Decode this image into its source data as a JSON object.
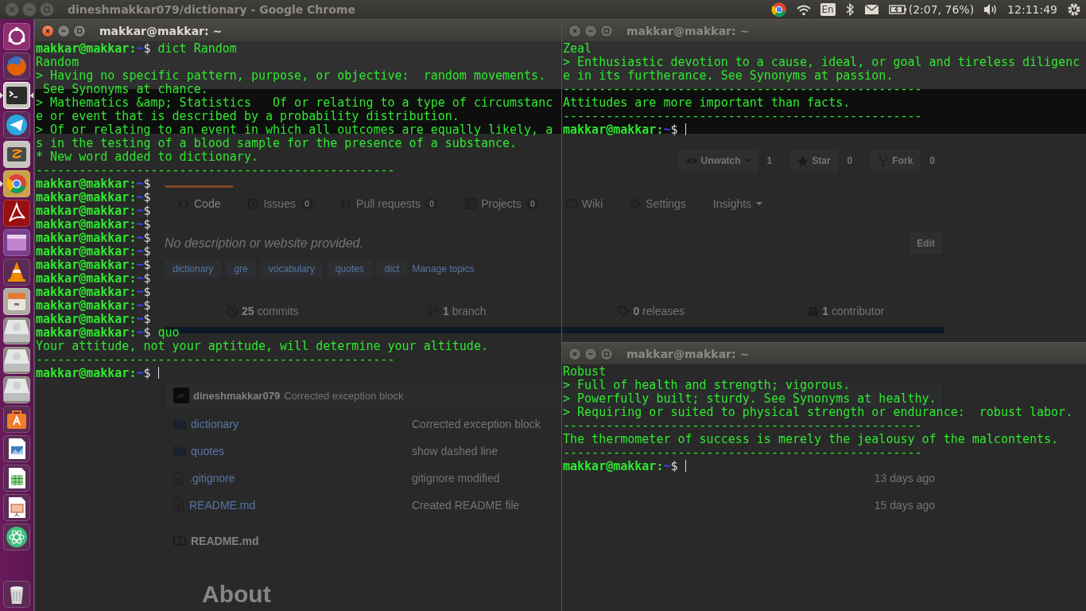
{
  "top_panel": {
    "window_title": "dineshmakkar079/dictionary - Google Chrome",
    "keyboard_layout": "En",
    "battery": "(2:07, 76%)",
    "clock": "12:11:49"
  },
  "launcher": [
    {
      "running": false,
      "focused": false
    },
    {
      "running": false,
      "focused": false
    },
    {
      "running": true,
      "focused": true
    },
    {
      "running": false,
      "focused": false
    },
    {
      "running": false,
      "focused": false
    },
    {
      "running": true,
      "focused": false
    },
    {
      "running": false,
      "focused": false
    },
    {
      "running": false,
      "focused": false
    },
    {
      "running": false,
      "focused": false
    },
    {
      "running": false,
      "focused": false
    },
    {
      "running": false,
      "focused": false
    },
    {
      "running": false,
      "focused": false
    },
    {
      "running": false,
      "focused": false
    },
    {
      "running": false,
      "focused": false
    },
    {
      "running": false,
      "focused": false
    },
    {
      "running": false,
      "focused": false
    },
    {
      "running": false,
      "focused": false
    },
    {
      "running": false,
      "focused": false
    },
    {
      "running": false,
      "focused": false
    }
  ],
  "browser_page": {
    "watch_buttons": [
      {
        "label": "Unwatch",
        "count": "1"
      },
      {
        "label": "Star",
        "count": "0"
      },
      {
        "label": "Fork",
        "count": "0"
      }
    ],
    "tabs": [
      {
        "label": "Code",
        "selected": true
      },
      {
        "label": "Issues",
        "count": "0",
        "selected": false
      },
      {
        "label": "Pull requests",
        "count": "0",
        "selected": false
      },
      {
        "label": "Projects",
        "count": "0",
        "selected": false
      },
      {
        "label": "Wiki",
        "selected": false
      },
      {
        "label": "Settings",
        "selected": false
      },
      {
        "label": "Insights",
        "selected": false
      }
    ],
    "description": "No description or website provided.",
    "edit_button": "Edit",
    "topics": [
      "dictionary",
      "gre",
      "vocabulary",
      "quotes",
      "dict"
    ],
    "manage_topics": "Manage topics",
    "stats": [
      {
        "count": "25",
        "label": "commits"
      },
      {
        "count": "1",
        "label": "branch"
      },
      {
        "count": "0",
        "label": "releases"
      },
      {
        "count": "1",
        "label": "contributor"
      }
    ],
    "last_commit": {
      "author": "dineshmakkar079",
      "message": "Corrected exception block"
    },
    "files": [
      {
        "kind": "folder",
        "name": "dictionary",
        "message": "Corrected exception block"
      },
      {
        "kind": "folder",
        "name": "quotes",
        "message": "show dashed line"
      },
      {
        "kind": "file",
        "name": ".gitignore",
        "message": "gitignore modified",
        "age": "13 days ago"
      },
      {
        "kind": "file",
        "name": "README.md",
        "message": "Created README file",
        "age": "15 days ago"
      }
    ],
    "readme": {
      "title": "README.md",
      "heading": "About"
    }
  },
  "terminals": [
    {
      "title": "makkar@makkar: ~",
      "active": true,
      "lines": [
        {
          "kind": "prompt",
          "user": "makkar@makkar:",
          "path": "~",
          "symbol": "$",
          "command": "dict Random",
          "cursor": false
        },
        {
          "kind": "output",
          "text": "Random"
        },
        {
          "kind": "output",
          "text": "> Having no specific pattern, purpose, or objective:  random movements."
        },
        {
          "kind": "output",
          "text": " See Synonyms at chance."
        },
        {
          "kind": "output",
          "text": "> Mathematics &amp; Statistics   Of or relating to a type of circumstanc"
        },
        {
          "kind": "output",
          "text": "e or event that is described by a probability distribution."
        },
        {
          "kind": "output",
          "text": "> Of or relating to an event in which all outcomes are equally likely, a"
        },
        {
          "kind": "output",
          "text": "s in the testing of a blood sample for the presence of a substance."
        },
        {
          "kind": "output",
          "text": "* New word added to dictionary."
        },
        {
          "kind": "rule",
          "text": "--------------------------------------------------"
        },
        {
          "kind": "prompt",
          "user": "makkar@makkar:",
          "path": "~",
          "symbol": "$",
          "cursor": false
        },
        {
          "kind": "prompt",
          "user": "makkar@makkar:",
          "path": "~",
          "symbol": "$",
          "cursor": false
        },
        {
          "kind": "prompt",
          "user": "makkar@makkar:",
          "path": "~",
          "symbol": "$",
          "cursor": false
        },
        {
          "kind": "prompt",
          "user": "makkar@makkar:",
          "path": "~",
          "symbol": "$",
          "cursor": false
        },
        {
          "kind": "prompt",
          "user": "makkar@makkar:",
          "path": "~",
          "symbol": "$",
          "cursor": false
        },
        {
          "kind": "prompt",
          "user": "makkar@makkar:",
          "path": "~",
          "symbol": "$",
          "cursor": false
        },
        {
          "kind": "prompt",
          "user": "makkar@makkar:",
          "path": "~",
          "symbol": "$",
          "cursor": false
        },
        {
          "kind": "prompt",
          "user": "makkar@makkar:",
          "path": "~",
          "symbol": "$",
          "cursor": false
        },
        {
          "kind": "prompt",
          "user": "makkar@makkar:",
          "path": "~",
          "symbol": "$",
          "cursor": false
        },
        {
          "kind": "prompt",
          "user": "makkar@makkar:",
          "path": "~",
          "symbol": "$",
          "cursor": false
        },
        {
          "kind": "prompt",
          "user": "makkar@makkar:",
          "path": "~",
          "symbol": "$",
          "cursor": false
        },
        {
          "kind": "prompt",
          "user": "makkar@makkar:",
          "path": "~",
          "symbol": "$",
          "command": "quo",
          "cursor": false
        },
        {
          "kind": "output",
          "text": "Your attitude, not your aptitude, will determine your altitude."
        },
        {
          "kind": "rule",
          "text": "--------------------------------------------------"
        },
        {
          "kind": "prompt",
          "user": "makkar@makkar:",
          "path": "~",
          "symbol": "$",
          "cursor": true
        }
      ]
    },
    {
      "title": "makkar@makkar: ~",
      "active": false,
      "lines": [
        {
          "kind": "output",
          "text": "Zeal"
        },
        {
          "kind": "output",
          "text": "> Enthusiastic devotion to a cause, ideal, or goal and tireless diligenc"
        },
        {
          "kind": "output",
          "text": "e in its furtherance. See Synonyms at passion."
        },
        {
          "kind": "rule",
          "text": "--------------------------------------------------"
        },
        {
          "kind": "output",
          "text": "Attitudes are more important than facts."
        },
        {
          "kind": "rule",
          "text": "--------------------------------------------------"
        },
        {
          "kind": "prompt",
          "user": "makkar@makkar:",
          "path": "~",
          "symbol": "$",
          "cursor": true
        }
      ]
    },
    {
      "title": "makkar@makkar: ~",
      "active": false,
      "lines": [
        {
          "kind": "output",
          "text": "Robust"
        },
        {
          "kind": "output",
          "text": "> Full of health and strength; vigorous."
        },
        {
          "kind": "output",
          "text": "> Powerfully built; sturdy. See Synonyms at healthy."
        },
        {
          "kind": "output",
          "text": "> Requiring or suited to physical strength or endurance:  robust labor."
        },
        {
          "kind": "rule",
          "text": "--------------------------------------------------"
        },
        {
          "kind": "output",
          "text": "The thermometer of success is merely the jealousy of the malcontents."
        },
        {
          "kind": "rule",
          "text": "--------------------------------------------------"
        },
        {
          "kind": "prompt",
          "user": "makkar@makkar:",
          "path": "~",
          "symbol": "$",
          "cursor": true
        }
      ]
    }
  ]
}
